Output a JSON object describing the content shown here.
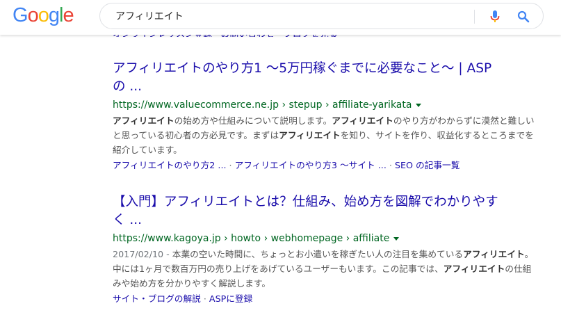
{
  "header": {
    "logo_letters": [
      {
        "char": "G",
        "color": "#4285F4"
      },
      {
        "char": "o",
        "color": "#EA4335"
      },
      {
        "char": "o",
        "color": "#FBBC05"
      },
      {
        "char": "g",
        "color": "#4285F4"
      },
      {
        "char": "l",
        "color": "#34A853"
      },
      {
        "char": "e",
        "color": "#EA4335"
      }
    ],
    "search_value": "アフィリエイト",
    "mic_icon": "microphone-icon",
    "search_icon": "magnifier-icon",
    "mic_color": "#4285F4",
    "search_color": "#4285F4"
  },
  "clipped_sitelinks_text": "オンラインレッスン登録 · お問い合わせ · ブログを見る",
  "results": [
    {
      "title_line1": "アフィリエイトのやり方1 〜5万円稼ぐまでに必要なこと〜 | ASP",
      "title_line2": "の ...",
      "url": "https://www.valuecommerce.ne.jp › stepup › affiliate-yarikata",
      "snippet": [
        {
          "text": "アフィリエイト",
          "bold": true
        },
        {
          "text": "の始め方や仕組みについて説明します。",
          "bold": false
        },
        {
          "text": "アフィリエイト",
          "bold": true
        },
        {
          "text": "のやり方がわからずに漠然と難しいと思っている初心者の方必見です。まずは",
          "bold": false
        },
        {
          "text": "アフィリエイト",
          "bold": true
        },
        {
          "text": "を知り、サイトを作り、収益化するところまでを紹介しています。",
          "bold": false
        }
      ],
      "sitelinks": [
        "アフィリエイトのやり方2 ...",
        "アフィリエイトのやり方3 〜サイト ...",
        "SEO の記事一覧"
      ]
    },
    {
      "title_line1": "【入門】アフィリエイトとは？仕組み、始め方を図解でわかりやす",
      "title_line2": "く ...",
      "url": "https://www.kagoya.jp › howto › webhomepage › affiliate",
      "date": "2017/02/10 - ",
      "snippet": [
        {
          "text": "本業の空いた時間に、ちょっとお小遣いを稼ぎたい人の注目を集めている",
          "bold": false
        },
        {
          "text": "アフィリエイト",
          "bold": true
        },
        {
          "text": "。中には1ヶ月で数百万円の売り上げをあげているユーザーもいます。この記事では、",
          "bold": false
        },
        {
          "text": "アフィリエイト",
          "bold": true
        },
        {
          "text": "の仕組みや始め方を分かりやすく解説します。",
          "bold": false
        }
      ],
      "sitelinks": [
        "サイト・ブログの解説",
        "ASPに登録"
      ]
    }
  ]
}
